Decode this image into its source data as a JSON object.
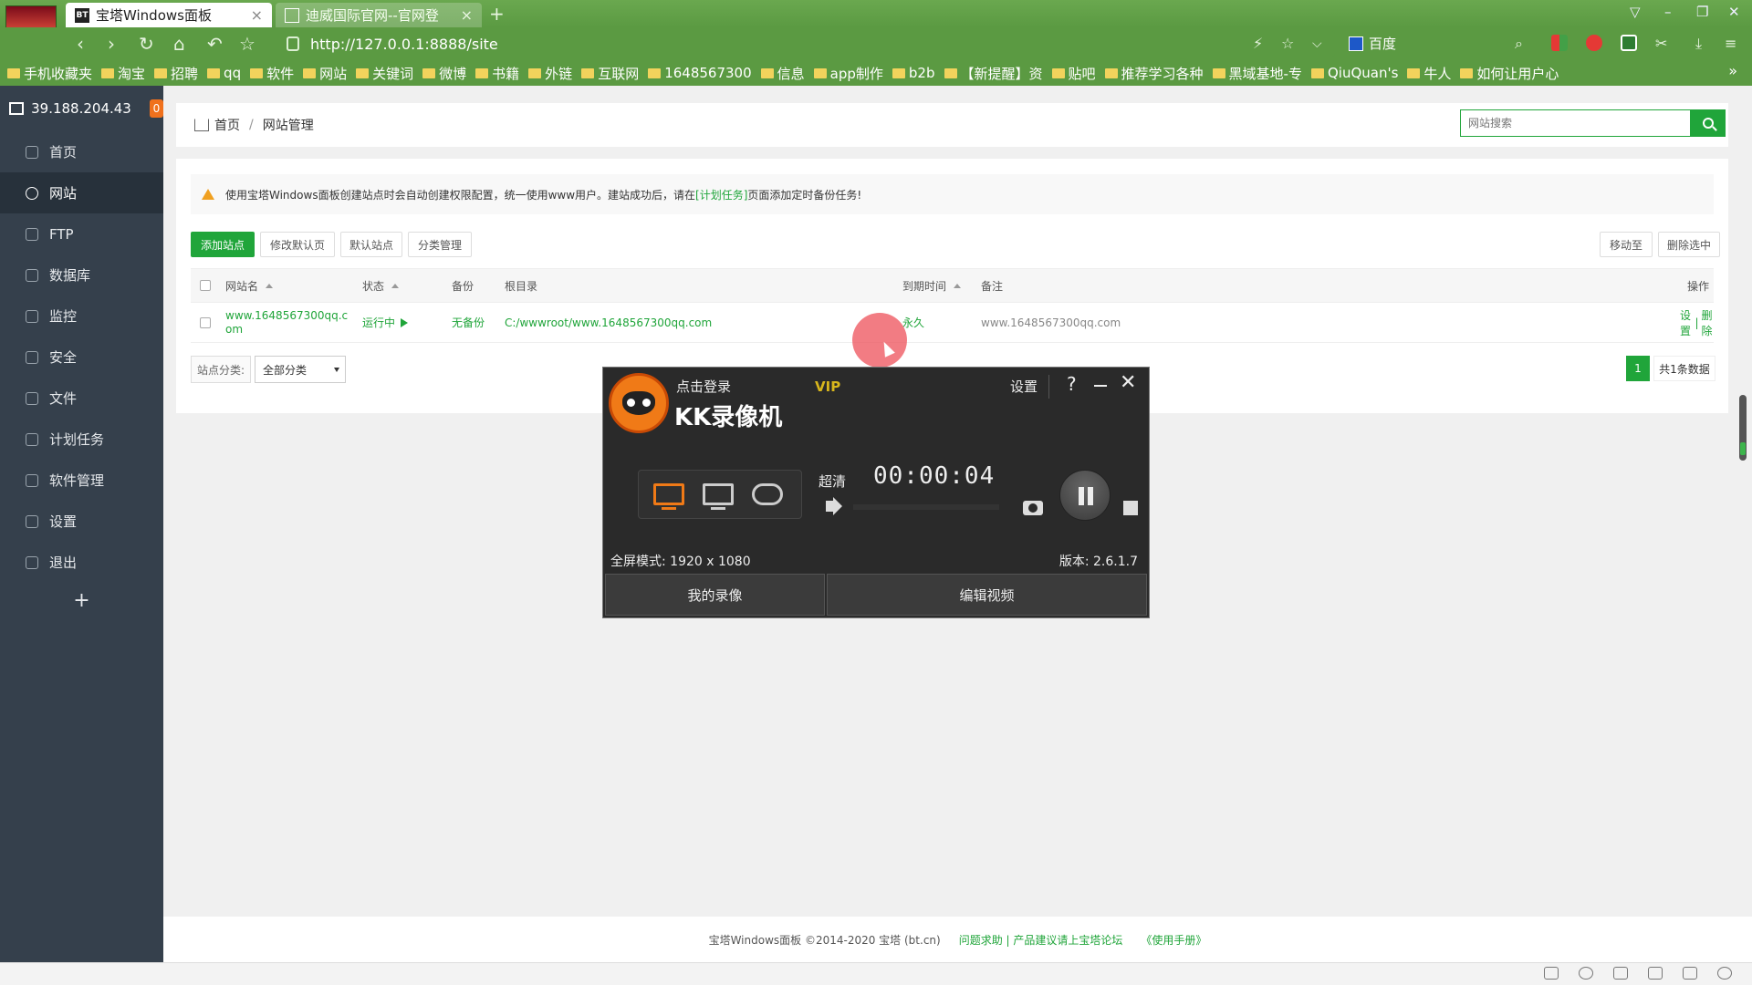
{
  "browser": {
    "tabs": [
      {
        "favicon": "BT",
        "label": "宝塔Windows面板"
      },
      {
        "favicon": "",
        "label": "迪威国际官网--官网登"
      }
    ],
    "url": "http://127.0.0.1:8888/site",
    "search_engine": "百度",
    "bookmarks": [
      "手机收藏夹",
      "淘宝",
      "招聘",
      "qq",
      "软件",
      "网站",
      "关键词",
      "微博",
      "书籍",
      "外链",
      "互联网",
      "1648567300",
      "信息",
      "app制作",
      "b2b",
      "【新提醒】资",
      "贴吧",
      "推荐学习各种",
      "黑域基地-专",
      "QiuQuan's",
      "牛人",
      "如何让用户心"
    ],
    "bookmarks_more": "»"
  },
  "sidebar": {
    "ip": "39.188.204.43",
    "badge": "0",
    "items": [
      {
        "label": "首页",
        "icon": "home-icon"
      },
      {
        "label": "网站",
        "icon": "globe-icon"
      },
      {
        "label": "FTP",
        "icon": "ftp-icon"
      },
      {
        "label": "数据库",
        "icon": "database-icon"
      },
      {
        "label": "监控",
        "icon": "monitor-icon"
      },
      {
        "label": "安全",
        "icon": "shield-icon"
      },
      {
        "label": "文件",
        "icon": "folder-icon"
      },
      {
        "label": "计划任务",
        "icon": "calendar-icon"
      },
      {
        "label": "软件管理",
        "icon": "apps-icon"
      },
      {
        "label": "设置",
        "icon": "gear-icon"
      },
      {
        "label": "退出",
        "icon": "logout-icon"
      }
    ],
    "active_item": "网站",
    "add": "+"
  },
  "breadcrumb": {
    "home": "首页",
    "sep": "/",
    "current": "网站管理"
  },
  "search": {
    "placeholder": "网站搜索"
  },
  "notice": {
    "before": "使用宝塔Windows面板创建站点时会自动创建权限配置，统一使用www用户。建站成功后，请在",
    "link": "[计划任务]",
    "after": "页面添加定时备份任务!"
  },
  "toolbar": {
    "add_site": "添加站点",
    "modify_default_page": "修改默认页",
    "default_site": "默认站点",
    "category_manage": "分类管理",
    "move_to": "移动至",
    "delete_selected": "删除选中"
  },
  "table": {
    "headers": {
      "name": "网站名",
      "status": "状态",
      "backup": "备份",
      "root": "根目录",
      "expire": "到期时间",
      "remark": "备注",
      "ops": "操作"
    },
    "rows": [
      {
        "name": "www.1648567300qq.com",
        "status": "运行中",
        "backup": "无备份",
        "root": "C:/wwwroot/www.1648567300qq.com",
        "expire": "永久",
        "remark": "www.1648567300qq.com",
        "op_settings": "设置",
        "op_sep": "|",
        "op_delete": "删除"
      }
    ]
  },
  "category": {
    "label": "站点分类:",
    "value": "全部分类"
  },
  "pagination": {
    "current": "1",
    "total": "共1条数据"
  },
  "footer": {
    "copyright": "宝塔Windows面板 ©2014-2020 宝塔 (bt.cn)",
    "help": "问题求助 | 产品建议请上宝塔论坛",
    "manual": "《使用手册》"
  },
  "recorder": {
    "login": "点击登录",
    "vip": "VIP",
    "title": "KK录像机",
    "settings": "设置",
    "help": "?",
    "quality": "超清",
    "timer": "00:00:04",
    "mode_info": "全屏模式: 1920 x 1080",
    "version": "版本: 2.6.1.7",
    "my_recordings": "我的录像",
    "edit_video": "编辑视频"
  },
  "colors": {
    "accent": "#20a53a",
    "browser_chrome": "#5b9a42",
    "sidebar": "#35404c",
    "badge": "#f0711d",
    "warning": "#f0a020",
    "recorder_orange": "#f07a17",
    "vip_gold": "#d8b61c"
  }
}
